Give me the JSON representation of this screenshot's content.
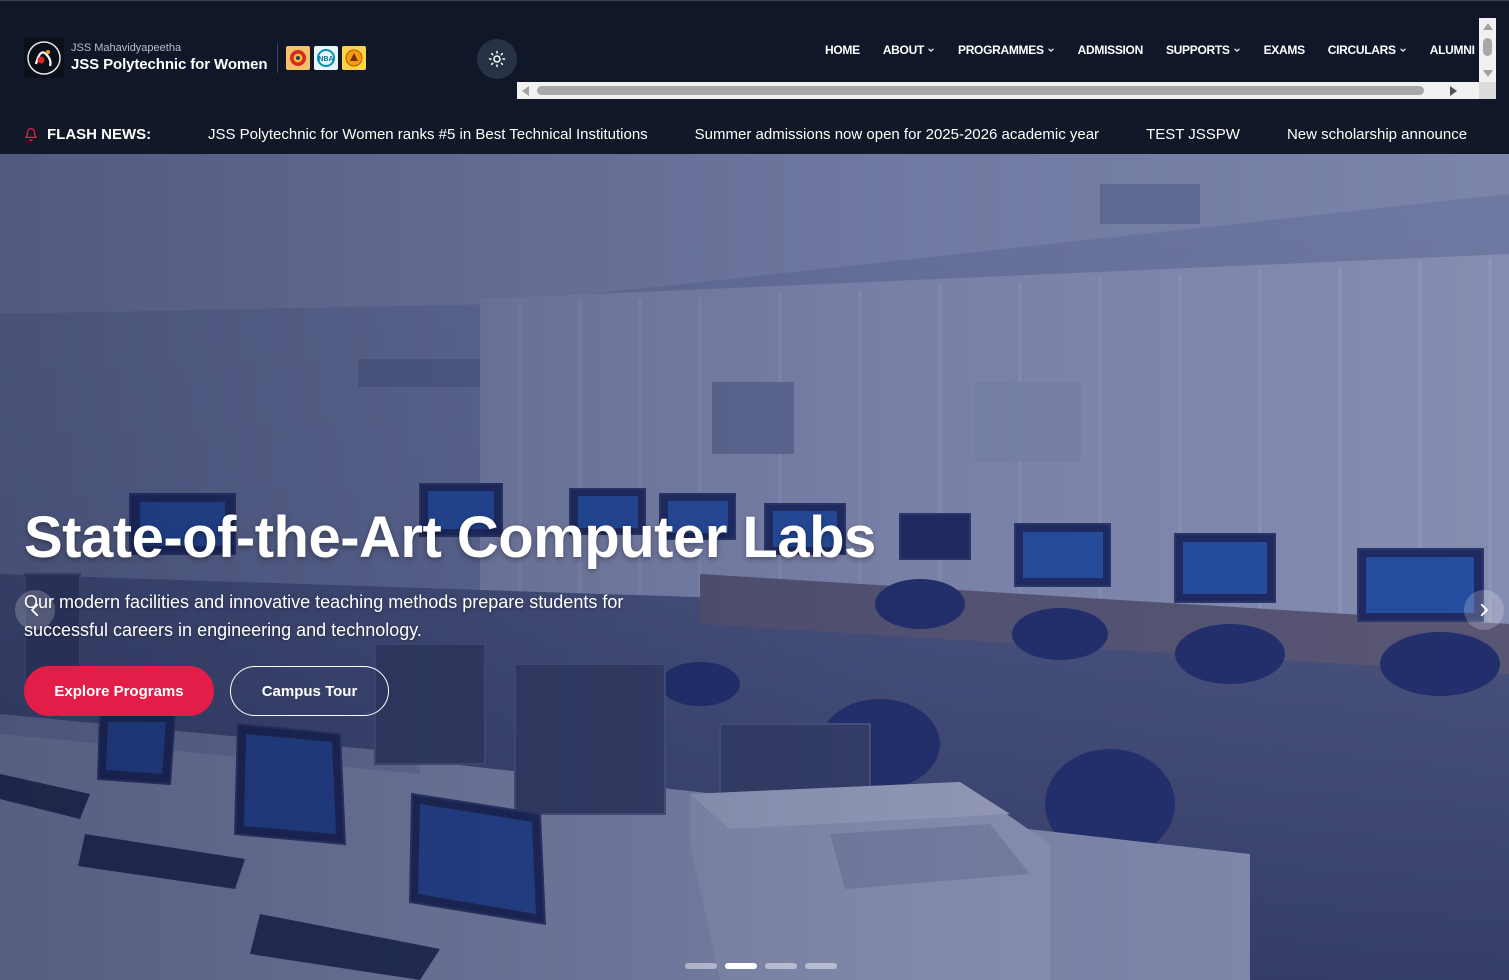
{
  "brand": {
    "parent": "JSS Mahavidyapeetha",
    "name": "JSS Polytechnic for Women",
    "badges": [
      "aicte-badge-icon",
      "nba-badge-icon",
      "government-seal-icon"
    ]
  },
  "nav": {
    "items": [
      {
        "label": "HOME",
        "dropdown": false
      },
      {
        "label": "ABOUT",
        "dropdown": true
      },
      {
        "label": "PROGRAMMES",
        "dropdown": true
      },
      {
        "label": "ADMISSION",
        "dropdown": false
      },
      {
        "label": "SUPPORTS",
        "dropdown": true
      },
      {
        "label": "EXAMS",
        "dropdown": false
      },
      {
        "label": "CIRCULARS",
        "dropdown": true
      },
      {
        "label": "ALUMNI",
        "dropdown": false
      }
    ]
  },
  "flash": {
    "label": "FLASH NEWS:",
    "items": [
      "JSS Polytechnic for Women ranks #5 in Best Technical Institutions",
      "Summer admissions now open for 2025-2026 academic year",
      "TEST JSSPW",
      "New scholarship announce"
    ]
  },
  "hero": {
    "title": "State-of-the-Art Computer Labs",
    "description": "Our modern facilities and innovative teaching methods prepare students for successful careers in engineering and technology.",
    "primary_cta": "Explore Programs",
    "secondary_cta": "Campus Tour",
    "slide_count": 4,
    "active_slide": 2
  },
  "colors": {
    "header_bg": "#0f1729",
    "accent": "#e11d48",
    "hero_tint": "#2c3a7a"
  }
}
